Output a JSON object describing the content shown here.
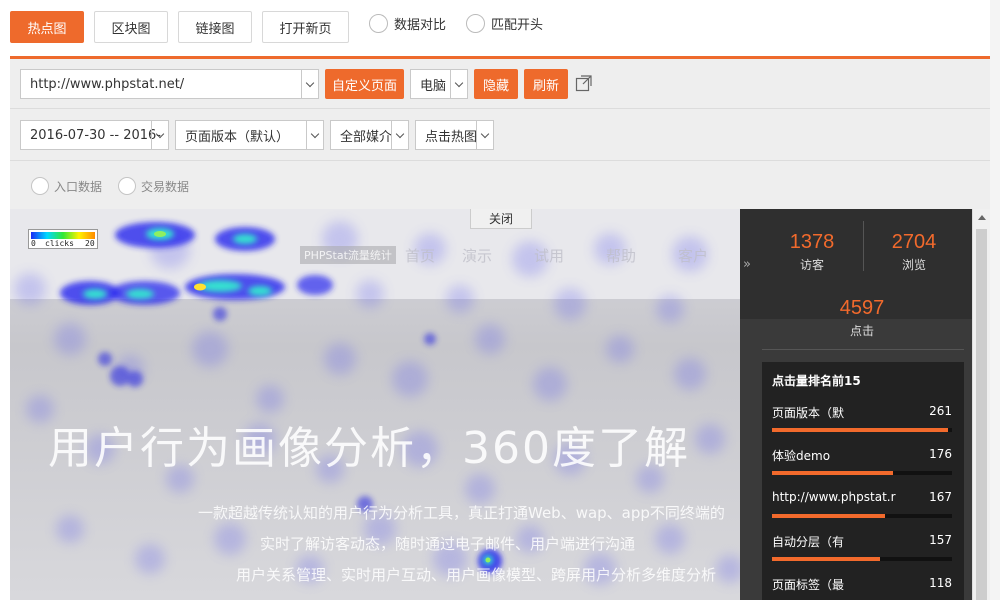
{
  "modes": [
    {
      "label": "热点图",
      "active": true
    },
    {
      "label": "区块图",
      "active": false
    },
    {
      "label": "链接图",
      "active": false
    },
    {
      "label": "打开新页",
      "active": false
    }
  ],
  "toggles": [
    "数据对比",
    "匹配开头"
  ],
  "controls": {
    "url": "http://www.phpstat.net/",
    "custom_page": "自定义页面",
    "device": "电脑",
    "hide": "隐藏",
    "refresh": "刷新",
    "date_range": "2016-07-30 -- 2016-",
    "page_version": "页面版本（默认）",
    "media": "全部媒介",
    "heat_type": "点击热图",
    "entry_data": "入口数据",
    "trade_data": "交易数据"
  },
  "preview": {
    "close": "关闭",
    "legend_min": "0",
    "legend_label": "clicks",
    "legend_max": "20",
    "hero_title": "用户行为画像分析，360度了解",
    "hero_sub1": "一款超越传统认知的用户行为分析工具，真正打通Web、wap、app不同终端的",
    "hero_sub2": "实时了解访客动态，随时通过电子邮件、用户端进行沟通",
    "hero_sub3": "用户关系管理、实时用户互动、用户画像模型、跨屏用户分析多维度分析",
    "logo_text": "PHPStat流量统计",
    "nav": [
      "首页",
      "演示",
      "试用",
      "帮助",
      "客户"
    ]
  },
  "stats": {
    "visitors": "1378",
    "visitors_label": "访客",
    "views": "2704",
    "views_label": "浏览",
    "clicks": "4597",
    "clicks_label": "点击",
    "rank_title": "点击量排名前15",
    "rank": [
      {
        "name": "页面版本（默",
        "value": 261,
        "share": 0.98
      },
      {
        "name": "体验demo",
        "value": 176,
        "share": 0.67
      },
      {
        "name": "http://www.phpstat.r",
        "value": 167,
        "share": 0.63
      },
      {
        "name": "自动分层（有",
        "value": 157,
        "share": 0.6
      },
      {
        "name": "页面标签（最",
        "value": 118,
        "share": 0.45
      }
    ]
  },
  "colors": {
    "accent": "#ee6a2c",
    "sidebar": "#3a3a3a"
  }
}
